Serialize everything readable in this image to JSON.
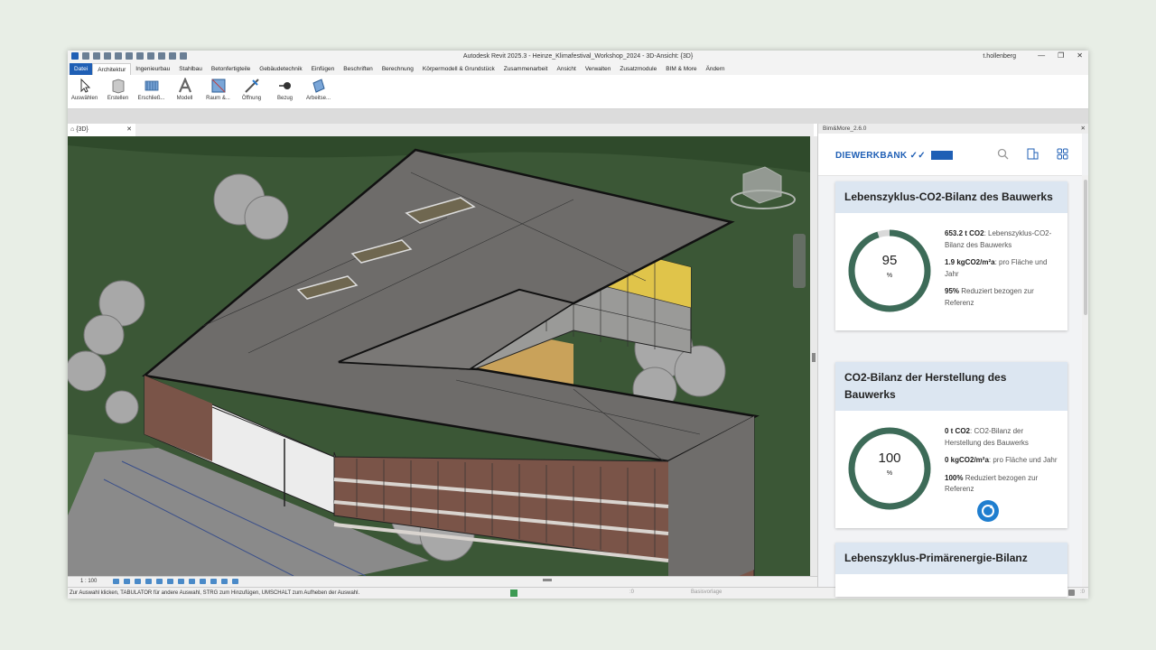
{
  "window": {
    "title": "Autodesk Revit 2025.3 - Heinze_Klimafestival_Workshop_2024 - 3D-Ansicht: {3D}",
    "user": "t.hollenberg"
  },
  "ribbon_tabs": [
    "Datei",
    "Architektur",
    "Ingenieurbau",
    "Stahlbau",
    "Betonfertigteile",
    "Gebäudetechnik",
    "Einfügen",
    "Beschriften",
    "Berechnung",
    "Körpermodell & Grundstück",
    "Zusammenarbeit",
    "Ansicht",
    "Verwalten",
    "Zusatzmodule",
    "BIM & More",
    "Ändern"
  ],
  "ribbon_buttons": [
    "Auswählen",
    "Erstellen",
    "Erschließ...",
    "Modell",
    "Raum &...",
    "Öffnung",
    "Bezug",
    "Arbeitse..."
  ],
  "view_tab": {
    "label": "{3D}",
    "close": "✕"
  },
  "view_bar": {
    "scale": "1 : 100"
  },
  "status": {
    "message": "Zur Auswahl klicken, TABULATOR für andere Auswahl, STRG zum Hinzufügen, UMSCHALT zum Aufheben der Auswahl.",
    "selection_count": ":0",
    "workset": "Basisvorlage",
    "filter_count": ":0"
  },
  "panel": {
    "title": "Bim&More_2.6.0",
    "brand": "DIEWERKBANK",
    "cards": [
      {
        "title": "Lebenszyklus-CO2-Bilanz des Bauwerks",
        "percent": "95",
        "unit": "%",
        "fraction": 0.95,
        "line1_val": "653.2 t CO2",
        "line1_text": ": Lebenszyklus-CO2-Bilanz des Bauwerks",
        "line2_val": "1.9 kgCO2/m²a",
        "line2_text": ": pro Fläche und Jahr",
        "line3_val": "95%",
        "line3_text": " Reduziert bezogen zur Referenz"
      },
      {
        "title": "CO2-Bilanz der Herstellung des Bauwerks",
        "percent": "100",
        "unit": "%",
        "fraction": 1.0,
        "line1_val": "0 t CO2",
        "line1_text": ": CO2-Bilanz der Herstellung des Bauwerks",
        "line2_val": "0 kgCO2/m²a",
        "line2_text": ": pro Fläche und Jahr",
        "line3_val": "100%",
        "line3_text": " Reduziert bezogen zur Referenz"
      },
      {
        "title": "Lebenszyklus-Primärenergie-Bilanz"
      }
    ]
  },
  "colors": {
    "accent": "#1f5fb5",
    "donut": "#3d6b58",
    "donut_track": "#d9d9d9"
  }
}
